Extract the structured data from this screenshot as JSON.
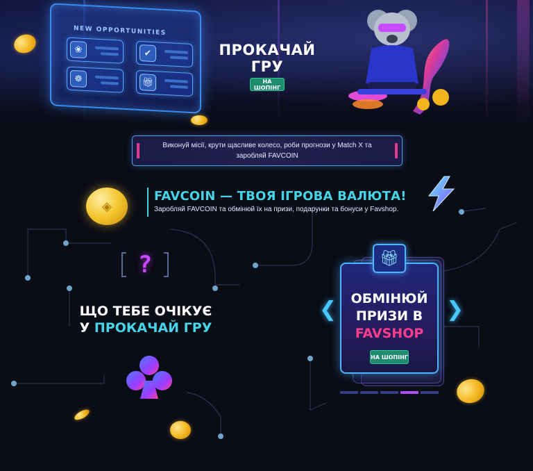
{
  "hero": {
    "panel_title": "NEW OPPORTUNITIES",
    "title": "ПРОКАЧАЙ ГРУ",
    "shop_button": "НА ШОПІНГ"
  },
  "info_strip": {
    "text": "Виконуй місії, крути щасливе колесо, роби прогнози у Match X та заробляй FAVCOIN"
  },
  "favcoin": {
    "title": "FAVCOIN — ТВОЯ ІГРОВА ВАЛЮТА!",
    "subtitle": "Заробляй FAVCOIN та обмінюй їх на призи, подарунки та бонуси у Favshop."
  },
  "expect": {
    "line1": "ЩО ТЕБЕ ОЧІКУЄ",
    "line2_prefix": "У ",
    "line2_highlight": "ПРОКАЧАЙ ГРУ"
  },
  "favshop_card": {
    "line1": "ОБМІНЮЙ",
    "line2": "ПРИЗИ В",
    "line3": "FAVSHOP",
    "shop_button": "НА ШОПІНГ",
    "prev_arrow": "❮",
    "next_arrow": "❯",
    "pager_active_index": 3,
    "pager_count": 5
  },
  "colors": {
    "accent_cyan": "#46d4e6",
    "accent_pink": "#ff3d8f",
    "button_green": "#1f8c6d",
    "background": "#0a0c16"
  },
  "icons": {
    "opp_tile_1": "leaf-badge-icon",
    "opp_tile_2": "checkmark-icon",
    "opp_tile_3": "wheel-icon",
    "opp_tile_4": "gift-icon",
    "card_badge": "gift-icon",
    "section_icon_1": "question-mark-icon",
    "section_icon_2": "club-suit-icon",
    "favcoin_badge": "coin-icon",
    "lightning": "lightning-bolt-icon"
  }
}
